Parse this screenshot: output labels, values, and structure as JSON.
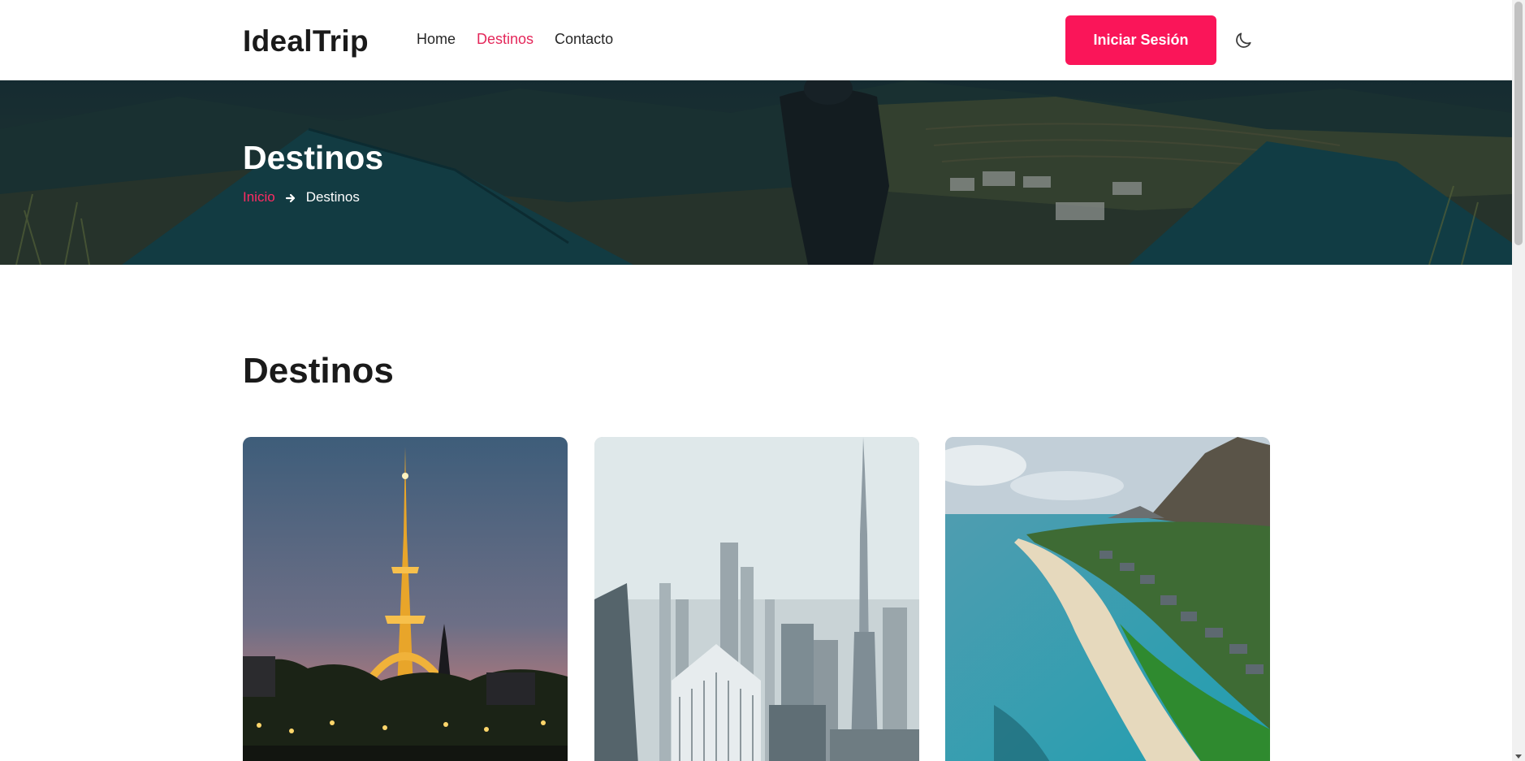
{
  "header": {
    "logo": "IdealTrip",
    "nav": [
      {
        "label": "Home",
        "active": false
      },
      {
        "label": "Destinos",
        "active": true
      },
      {
        "label": "Contacto",
        "active": false
      }
    ],
    "login_label": "Iniciar Sesión",
    "theme_icon": "moon-icon"
  },
  "hero": {
    "title": "Destinos",
    "breadcrumb": {
      "home": "Inicio",
      "separator_icon": "arrow-right-icon",
      "current": "Destinos"
    }
  },
  "main": {
    "section_title": "Destinos",
    "cards": [
      {
        "image": "eiffel-tower-night-photo"
      },
      {
        "image": "dubai-skyline-photo"
      },
      {
        "image": "tropical-beach-aerial-photo"
      }
    ]
  },
  "colors": {
    "accent": "#fa1559",
    "nav_active": "#e4275a",
    "breadcrumb_link": "#ff2b63"
  }
}
